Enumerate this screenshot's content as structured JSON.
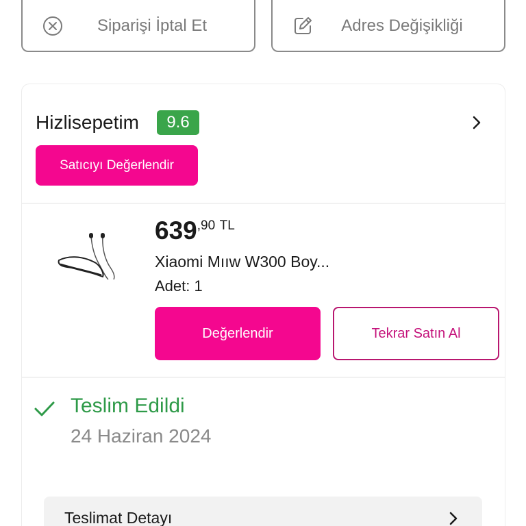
{
  "actions": {
    "cancel_order": {
      "label": "Siparişi İptal Et",
      "icon": "cancel-circle-icon"
    },
    "address_change": {
      "label": "Adres Değişikliği",
      "icon": "edit-icon"
    }
  },
  "seller": {
    "name": "Hizlisepetim",
    "score": "9.6",
    "score_color": "#3aa54a",
    "rate_button": "Satıcıyı Değerlendir"
  },
  "product": {
    "price_integer": "639",
    "price_fraction": ",90",
    "currency": "TL",
    "name": "Xiaomi Mııw W300 Boy...",
    "quantity": "Adet: 1",
    "review_button": "Değerlendir",
    "rebuy_button": "Tekrar Satın Al"
  },
  "delivery": {
    "status": "Teslim Edildi",
    "date": "24 Haziran 2024",
    "status_color": "#2e9a48",
    "detail_label": "Teslimat Detayı"
  },
  "colors": {
    "accent": "#f4078f",
    "rebuy_border": "#b8166f"
  }
}
